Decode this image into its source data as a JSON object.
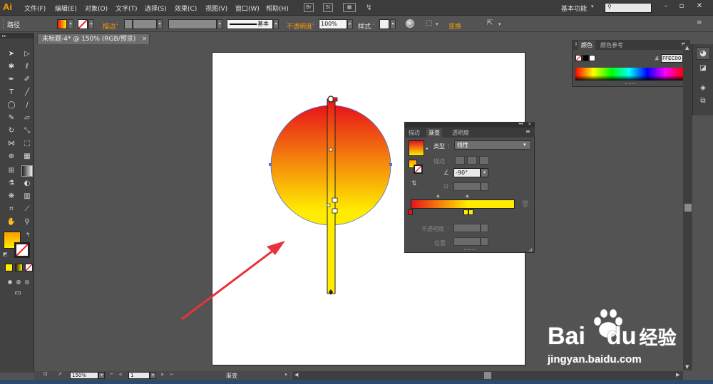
{
  "app": {
    "logo": "Ai",
    "menu": [
      "文件(F)",
      "编辑(E)",
      "对象(O)",
      "文字(T)",
      "选择(S)",
      "效果(C)",
      "视图(V)",
      "窗口(W)",
      "帮助(H)"
    ],
    "br_icon": "Br",
    "st_icon": "St",
    "workspace": "基本功能",
    "search_placeholder": ""
  },
  "control_bar": {
    "selection_label": "路径",
    "stroke_label": "描边",
    "stroke_style": "基本",
    "opacity_label": "不透明度",
    "opacity_value": "100%",
    "style_label": "样式",
    "transform_label": "变换"
  },
  "document": {
    "tab_title": "未标题-4* @ 150% (RGB/预览)"
  },
  "color_panel": {
    "tab_color": "颜色",
    "tab_guide": "颜色参考",
    "hex_prefix": "#",
    "hex_value": "FFEC00"
  },
  "gradient_panel": {
    "tab_stroke": "描边",
    "tab_gradient": "渐变",
    "tab_transparency": "透明度",
    "type_label": "类型",
    "type_value": "线性",
    "stroke_label": "描边",
    "angle_value": "-90°",
    "opacity_label": "不透明度",
    "position_label": "位置",
    "start_color": "#e8141a",
    "end_color": "#ffec00"
  },
  "status_bar": {
    "zoom": "150%",
    "page": "1",
    "tool_name": "渐变"
  },
  "watermark": {
    "brand_left": "Bai",
    "brand_right": "du",
    "brand_cn": "经验",
    "url": "jingyan.baidu.com"
  },
  "colors": {
    "accent": "#ff9a00",
    "fill_start": "#e8141a",
    "fill_end": "#ffec00",
    "arrow": "#e8333a"
  }
}
